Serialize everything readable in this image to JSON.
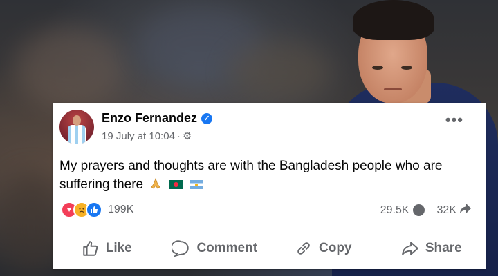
{
  "post": {
    "author_name": "Enzo Fernandez",
    "timestamp": "19 July at 10:04",
    "separator": "·",
    "audience_icon": "gear-icon",
    "more_label": "•••",
    "text_line1": "My prayers and thoughts are with the Bangladesh people who are",
    "text_line2": "suffering there",
    "emojis": [
      "folded-hands",
      "bangladesh-flag",
      "argentina-flag"
    ]
  },
  "engagement": {
    "reaction_icons": [
      "love",
      "sad",
      "like"
    ],
    "reaction_count": "199K",
    "comment_count": "29.5K",
    "share_count": "32K"
  },
  "actions": {
    "like_label": "Like",
    "comment_label": "Comment",
    "copy_label": "Copy",
    "share_label": "Share"
  },
  "colors": {
    "verified_badge": "#1877f2",
    "meta_text": "#65676b",
    "love": "#f33e58",
    "sad": "#f7b125",
    "like": "#1877f2"
  }
}
